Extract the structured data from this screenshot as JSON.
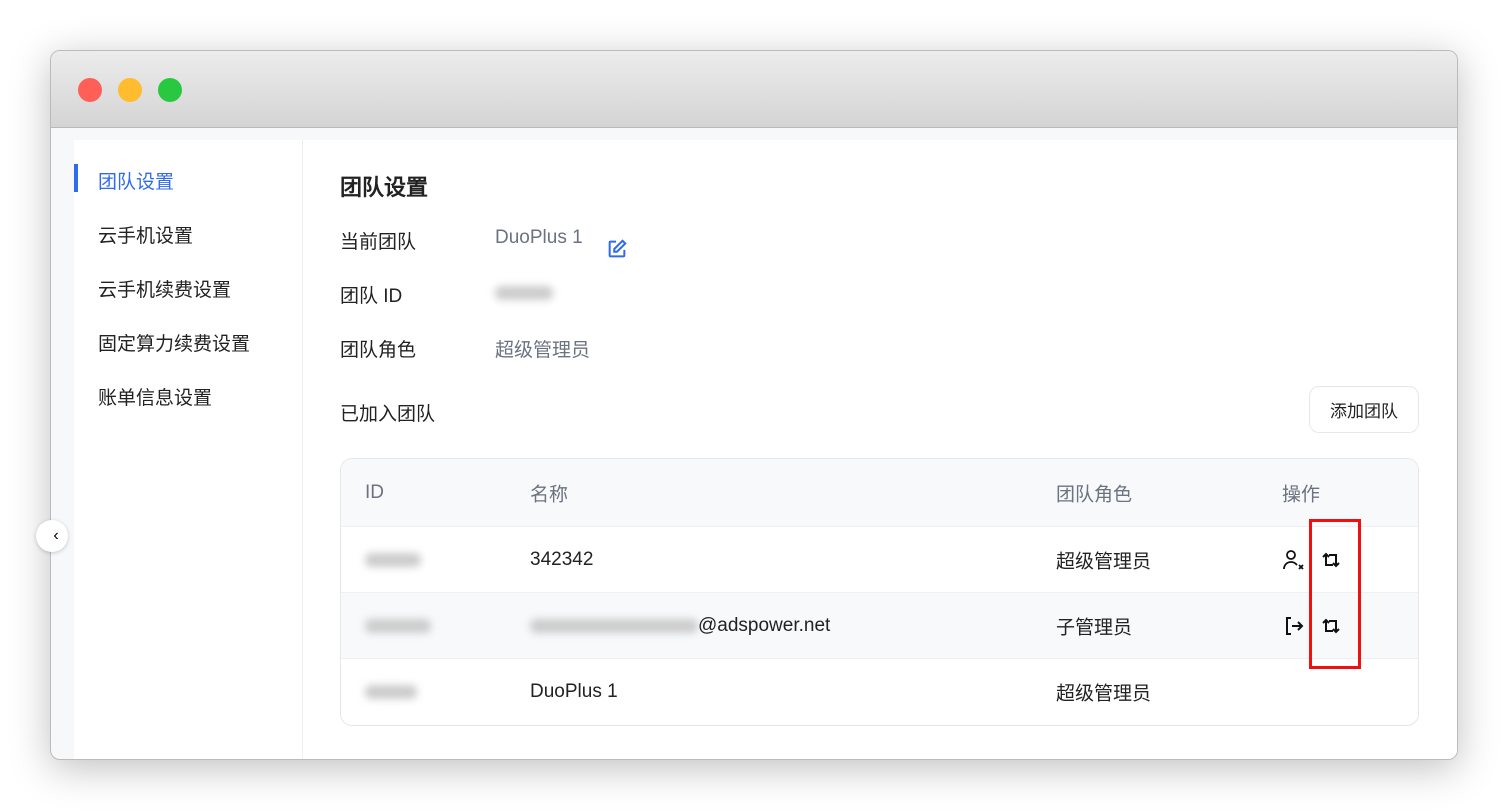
{
  "sidebar": {
    "items": [
      {
        "label": "团队设置",
        "active": true
      },
      {
        "label": "云手机设置"
      },
      {
        "label": "云手机续费设置"
      },
      {
        "label": "固定算力续费设置"
      },
      {
        "label": "账单信息设置"
      }
    ]
  },
  "main": {
    "title": "团队设置",
    "current_team_label": "当前团队",
    "current_team_value": "DuoPlus 1",
    "team_id_label": "团队 ID",
    "team_role_label": "团队角色",
    "team_role_value": "超级管理员",
    "joined_label": "已加入团队",
    "add_team_button": "添加团队",
    "table": {
      "headers": [
        "ID",
        "名称",
        "团队角色",
        "操作"
      ],
      "rows": [
        {
          "name": "342342",
          "role": "超级管理员",
          "actions": [
            "remove-user-icon",
            "switch-icon"
          ]
        },
        {
          "name": "@adspower.net",
          "role": "子管理员",
          "actions": [
            "exit-icon",
            "switch-icon"
          ]
        },
        {
          "name": "DuoPlus 1",
          "role": "超级管理员",
          "actions": []
        }
      ]
    }
  },
  "colors": {
    "accent": "#2f6bea",
    "highlight": "#f01010"
  }
}
